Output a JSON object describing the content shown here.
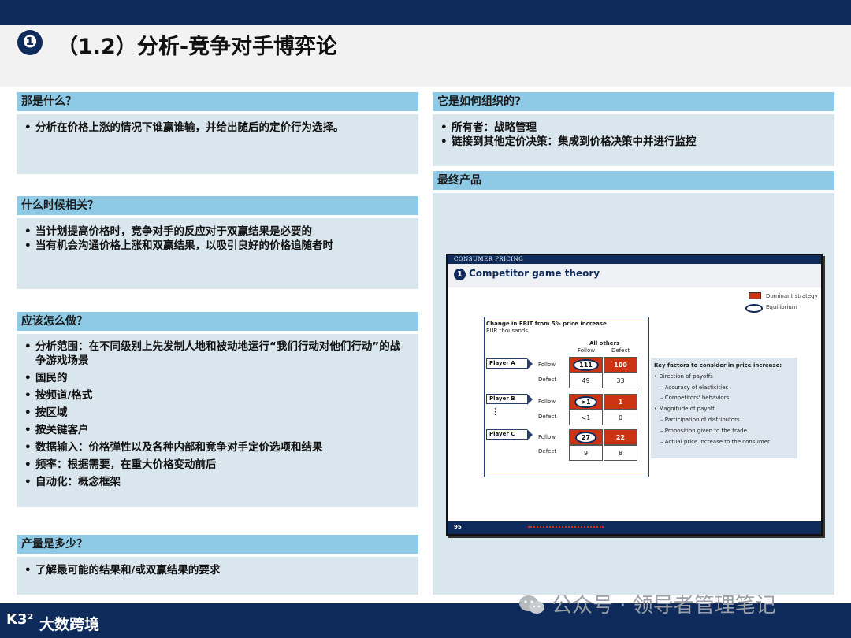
{
  "header": {
    "badge": "❶",
    "title": "（1.2）分析-竞争对手博弈论"
  },
  "sections": {
    "what": {
      "header": "那是什么？",
      "bullets": [
        "分析在价格上涨的情况下谁赢谁输，并给出随后的定价行为选择。"
      ]
    },
    "when": {
      "header": "什么时候相关？",
      "bullets": [
        "当计划提高价格时，竞争对手的反应对于双赢结果是必要的",
        "当有机会沟通价格上涨和双赢结果，以吸引良好的价格追随者时"
      ]
    },
    "how": {
      "header": "应该怎么做？",
      "bullets": [
        "分析范围：在不同级别上先发制人地和被动地运行“我们行动对他们行动”的战争游戏场景",
        "国民的",
        "按频道/格式",
        "按区域",
        "按关键客户",
        "数据输入：价格弹性以及各种内部和竞争对手定价选项和结果",
        "频率：根据需要，在重大价格变动前后",
        "自动化：概念框架"
      ]
    },
    "output": {
      "header": "产量是多少？",
      "bullets": [
        "了解最可能的结果和/或双赢结果的要求"
      ]
    },
    "org": {
      "header": "它是如何组织的?",
      "bullets": [
        "所有者：战略管理",
        "链接到其他定价决策：集成到价格决策中并进行监控"
      ]
    },
    "product": {
      "header": "最终产品"
    }
  },
  "slide": {
    "topbar": "CONSUMER PRICING",
    "number": "1",
    "title": "Competitor game theory",
    "legend": {
      "dominant": "Dominant strategy",
      "equilibrium": "Equilibrium"
    },
    "matrix": {
      "title": "Change in EBIT from 5% price increase",
      "unit": "EUR thousands",
      "col_group": "All others",
      "col_follow": "Follow",
      "col_defect": "Defect",
      "row_follow": "Follow",
      "row_defect": "Defect",
      "players": [
        {
          "name": "Player A",
          "follow_follow": "111",
          "follow_defect": "100",
          "defect_follow": "49",
          "defect_defect": "33"
        },
        {
          "name": "Player B",
          "follow_follow": ">1",
          "follow_defect": "1",
          "defect_follow": "<1",
          "defect_defect": "0"
        },
        {
          "name": "Player C",
          "follow_follow": "27",
          "follow_defect": "22",
          "defect_follow": "9",
          "defect_defect": "8"
        }
      ],
      "ellipsis": "⋮"
    },
    "factors": {
      "title": "Key factors to consider in price increase:",
      "lines": [
        "• Direction of payoffs",
        "– Accuracy of elasticities",
        "– Competitors' behaviors",
        "• Magnitude of payoff",
        "– Participation of distributors",
        "– Proposition given to the trade",
        "– Actual price increase to the consumer"
      ]
    },
    "footer_num": "95"
  },
  "footer": {
    "logo": "K3²",
    "brand": "大数跨境",
    "watermark": "公众号 · 领导者管理笔记"
  },
  "colors": {
    "navy": "#0f2b5b",
    "header_blue": "#8ecae6",
    "body_bg": "#d9e6ee",
    "dominant_red": "#cc3312"
  }
}
